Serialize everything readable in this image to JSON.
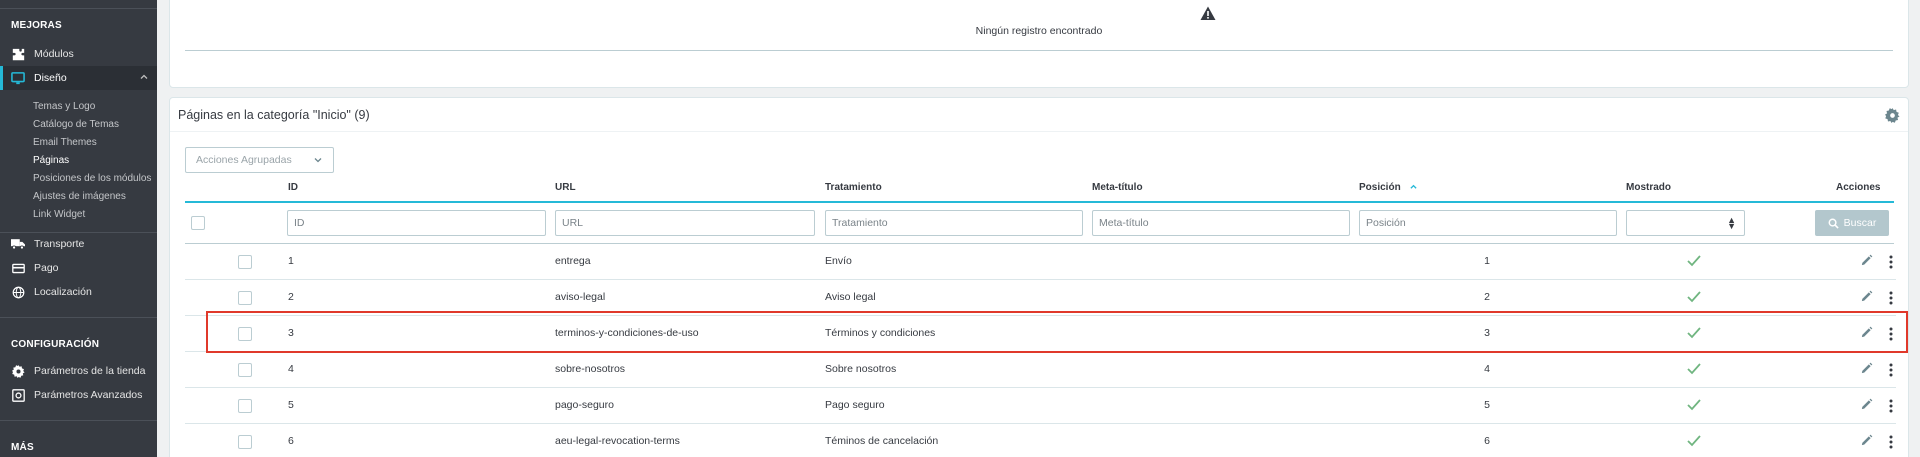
{
  "sidebar": {
    "section_mejoras": "MEJORAS",
    "items": [
      {
        "label": "Módulos",
        "icon": "puzzle-icon"
      },
      {
        "label": "Diseño",
        "icon": "monitor-icon"
      }
    ],
    "design_sub": [
      "Temas y Logo",
      "Catálogo de Temas",
      "Email Themes",
      "Páginas",
      "Posiciones de los módulos",
      "Ajustes de imágenes",
      "Link Widget"
    ],
    "items2": [
      {
        "label": "Transporte",
        "icon": "truck-icon"
      },
      {
        "label": "Pago",
        "icon": "credit-card-icon"
      },
      {
        "label": "Localización",
        "icon": "globe-icon"
      }
    ],
    "section_config": "CONFIGURACIÓN",
    "config_items": [
      {
        "label": "Parámetros de la tienda",
        "icon": "gear-icon"
      },
      {
        "label": "Parámetros Avanzados",
        "icon": "advanced-settings-icon"
      }
    ],
    "section_mas": "MÁS"
  },
  "top_panel": {
    "empty_text": "Ningún registro encontrado"
  },
  "list_panel": {
    "title": "Páginas en la categoría \"Inicio\" (9)",
    "bulk_actions": "Acciones Agrupadas",
    "columns": {
      "id": "ID",
      "url": "URL",
      "tratamiento": "Tratamiento",
      "meta": "Meta-título",
      "posicion": "Posición",
      "mostrado": "Mostrado",
      "acciones": "Acciones"
    },
    "filters": {
      "id": "ID",
      "url": "URL",
      "tratamiento": "Tratamiento",
      "meta": "Meta-título",
      "posicion": "Posición"
    },
    "search_label": "Buscar",
    "rows": [
      {
        "id": "1",
        "url": "entrega",
        "tratamiento": "Envío",
        "posicion": "1"
      },
      {
        "id": "2",
        "url": "aviso-legal",
        "tratamiento": "Aviso legal",
        "posicion": "2"
      },
      {
        "id": "3",
        "url": "terminos-y-condiciones-de-uso",
        "tratamiento": "Términos y condiciones",
        "posicion": "3"
      },
      {
        "id": "4",
        "url": "sobre-nosotros",
        "tratamiento": "Sobre nosotros",
        "posicion": "4"
      },
      {
        "id": "5",
        "url": "pago-seguro",
        "tratamiento": "Pago seguro",
        "posicion": "5"
      },
      {
        "id": "6",
        "url": "aeu-legal-revocation-terms",
        "tratamiento": "Téminos de cancelación",
        "posicion": "6"
      }
    ]
  },
  "colors": {
    "sidebar_bg": "#363a41",
    "accent": "#25b9d7",
    "check_green": "#70b580",
    "highlight_red": "#e0392b"
  }
}
